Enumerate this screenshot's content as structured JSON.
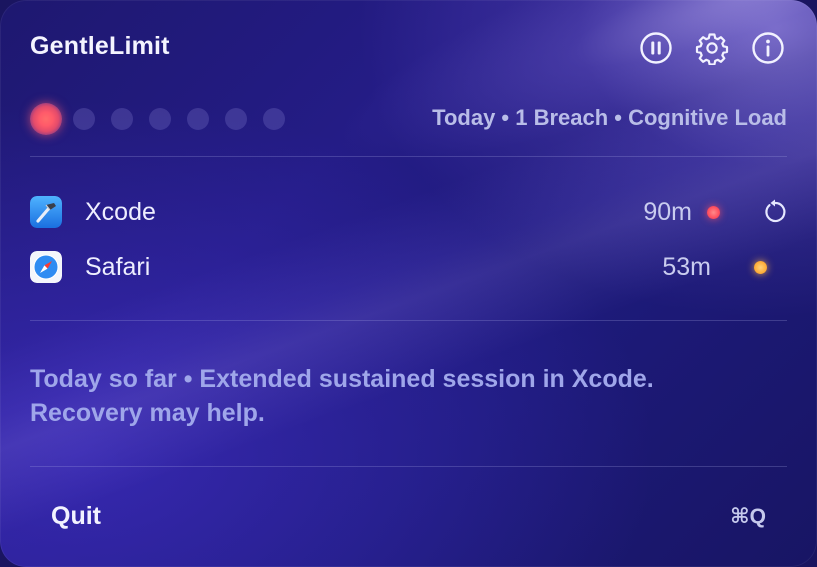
{
  "header": {
    "title": "GentleLimit",
    "icons": [
      "pause-icon",
      "gear-icon",
      "info-icon"
    ]
  },
  "summary": {
    "dots_total": 7,
    "dots_active": 1,
    "status_text": "Today • 1 Breach • Cognitive Load"
  },
  "apps": [
    {
      "name": "Xcode",
      "time": "90m",
      "status_color": "#ff5a6a",
      "icon": "xcode-icon",
      "has_reset": true
    },
    {
      "name": "Safari",
      "time": "53m",
      "status_color": "#ffb347",
      "icon": "safari-icon",
      "has_reset": false
    }
  ],
  "message": {
    "line1": "Today so far • Extended sustained session in Xcode.",
    "line2": "Recovery may help."
  },
  "footer": {
    "quit_label": "Quit",
    "shortcut": "⌘Q"
  },
  "colors": {
    "background": "#1e1870",
    "alert_red": "#ff5a6a",
    "warning_amber": "#ffb347",
    "muted_text": "#9fa6ea"
  }
}
